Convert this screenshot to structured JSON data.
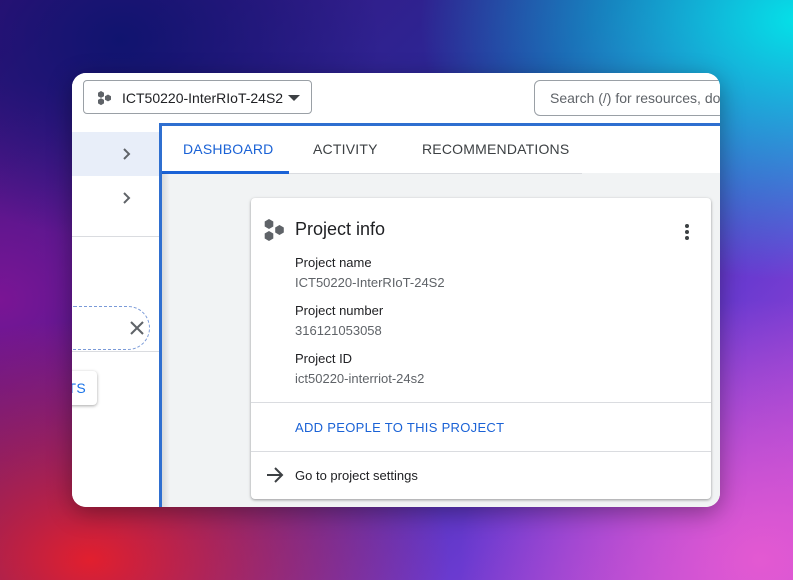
{
  "topbar": {
    "project_name": "ICT50220-InterRIoT-24S2",
    "search_placeholder": "Search (/) for resources, docs, products, and more"
  },
  "sidebar": {
    "button_label": "TS"
  },
  "tabs": [
    {
      "label": "DASHBOARD"
    },
    {
      "label": "ACTIVITY"
    },
    {
      "label": "RECOMMENDATIONS"
    }
  ],
  "card": {
    "title": "Project info",
    "fields": [
      {
        "label": "Project name",
        "value": "ICT50220-InterRIoT-24S2"
      },
      {
        "label": "Project number",
        "value": "316121053058"
      },
      {
        "label": "Project ID",
        "value": "ict50220-interriot-24s2"
      }
    ],
    "add_people": "ADD PEOPLE TO THIS PROJECT",
    "settings": "Go to project settings"
  },
  "colors": {
    "accent": "#1a62d6",
    "selection_bg": "#e8eef9",
    "focus_border": "#2f6fd0"
  },
  "icons": [
    "project-hexagons-icon",
    "caret-down-icon",
    "chevron-right-icon",
    "close-icon",
    "more-vert-icon",
    "arrow-right-icon"
  ]
}
